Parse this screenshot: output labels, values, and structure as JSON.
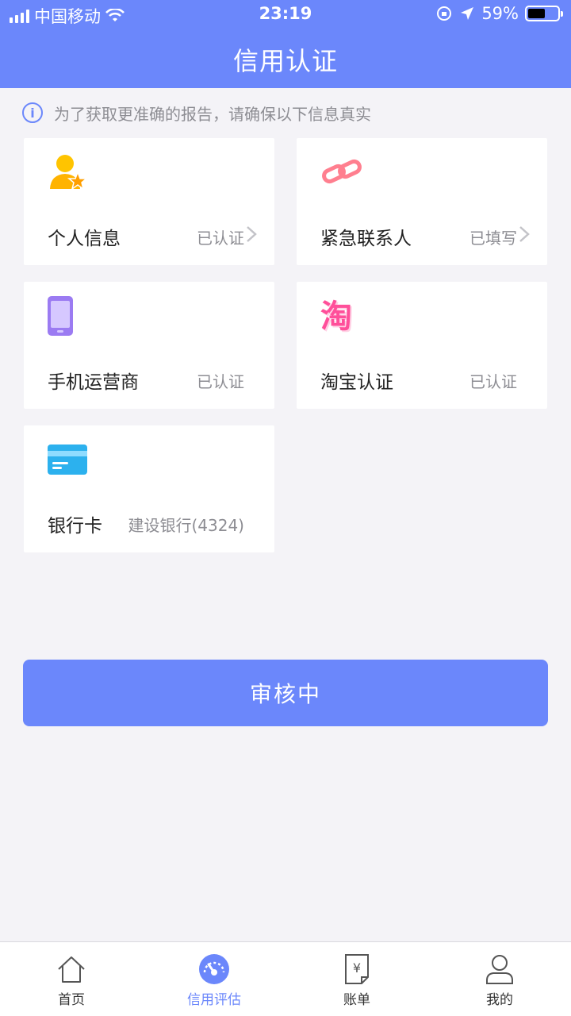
{
  "status_bar": {
    "carrier": "中国移动",
    "time": "23:19",
    "battery": "59%"
  },
  "header": {
    "title": "信用认证"
  },
  "notice": {
    "text": "为了获取更准确的报告，请确保以下信息真实"
  },
  "cards": [
    {
      "label": "个人信息",
      "status": "已认证",
      "icon": "person-star-icon",
      "has_arrow": true
    },
    {
      "label": "紧急联系人",
      "status": "已填写",
      "icon": "link-icon",
      "has_arrow": true
    },
    {
      "label": "手机运营商",
      "status": "已认证",
      "icon": "phone-icon",
      "has_arrow": false
    },
    {
      "label": "淘宝认证",
      "status": "已认证",
      "icon": "taobao-icon",
      "glyph": "淘",
      "has_arrow": false
    },
    {
      "label": "银行卡",
      "status": "建设银行(4324)",
      "icon": "bank-card-icon",
      "has_arrow": false
    }
  ],
  "button": {
    "label": "审核中"
  },
  "tabs": [
    {
      "label": "首页",
      "icon": "home-icon",
      "active": false
    },
    {
      "label": "信用评估",
      "icon": "gauge-icon",
      "active": true
    },
    {
      "label": "账单",
      "icon": "bill-icon",
      "active": false
    },
    {
      "label": "我的",
      "icon": "user-icon",
      "active": false
    }
  ],
  "colors": {
    "accent": "#6b87fb",
    "background": "#f4f3f7"
  }
}
